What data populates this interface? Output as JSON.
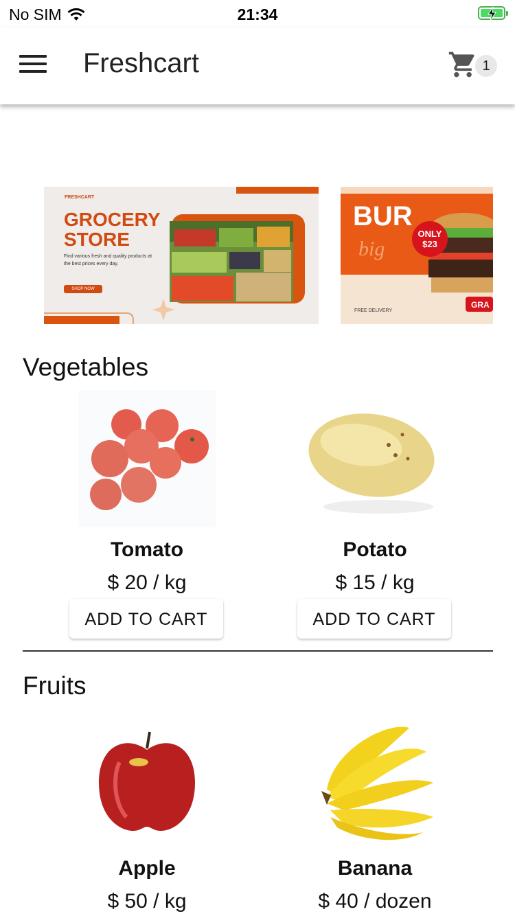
{
  "status_bar": {
    "carrier": "No SIM",
    "time": "21:34"
  },
  "app_bar": {
    "title": "Freshcart",
    "cart_count": "1"
  },
  "banners": [
    {
      "brand": "FRESHCART",
      "title_line1": "GROCERY",
      "title_line2": "STORE",
      "description": "Find various fresh and quality products at the best prices every day.",
      "button": "SHOP NOW"
    },
    {
      "headline": "BUR",
      "script": "big",
      "price_tag_line1": "ONLY",
      "price_tag_line2": "$23",
      "footer": "FREE DELIVERY",
      "corner": "GRA"
    }
  ],
  "sections": [
    {
      "title": "Vegetables",
      "items": [
        {
          "name": "Tomato",
          "price": "$ 20 / kg",
          "button": "ADD TO CART"
        },
        {
          "name": "Potato",
          "price": "$ 15 / kg",
          "button": "ADD TO CART"
        }
      ]
    },
    {
      "title": "Fruits",
      "items": [
        {
          "name": "Apple",
          "price": "$ 50 / kg"
        },
        {
          "name": "Banana",
          "price": "$ 40 / dozen"
        }
      ]
    }
  ],
  "colors": {
    "brand_orange": "#e85a16",
    "battery_green": "#4cd964"
  }
}
